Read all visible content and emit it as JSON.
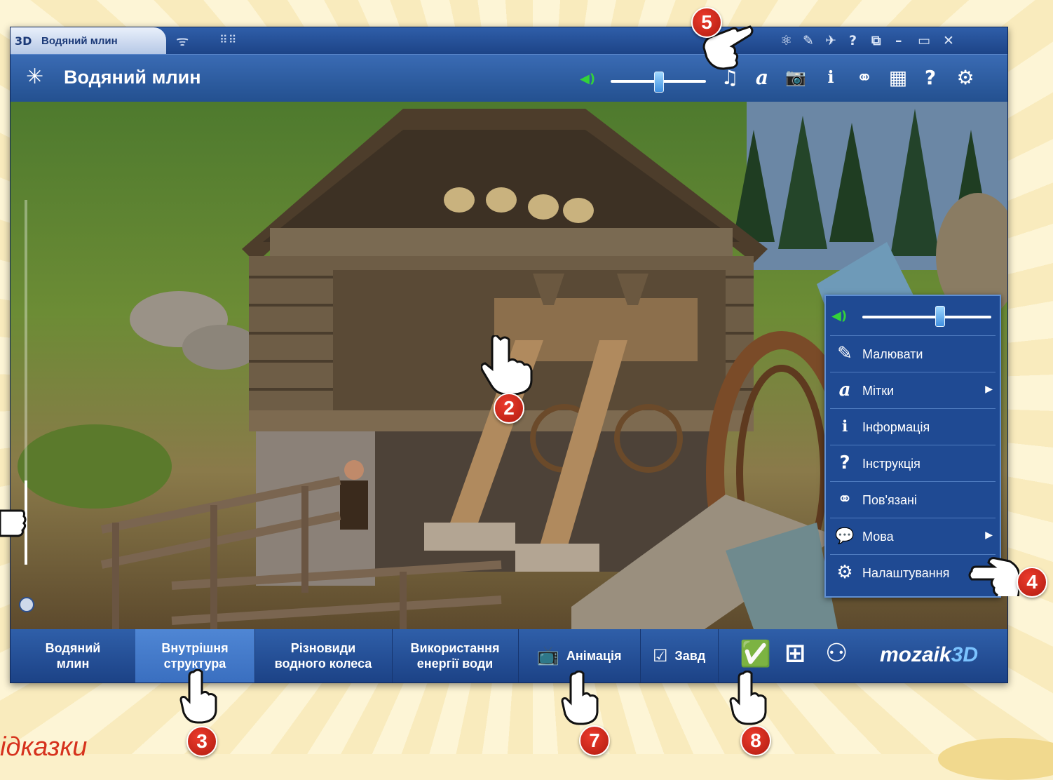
{
  "window": {
    "tab_badge": "3D",
    "tab_title": "Водяний млин",
    "titlebar_icons": [
      "molecule-icon",
      "pencil-icon",
      "pin-icon",
      "help-icon",
      "external-link-icon",
      "minimize-icon",
      "maximize-icon",
      "close-icon"
    ],
    "titlebar_glyphs": [
      "⚛",
      "✎",
      "✈",
      "?",
      "⧉",
      "–",
      "▭",
      "✕"
    ]
  },
  "header": {
    "title": "Водяний млин",
    "volume_level": 0.5,
    "icons": [
      "music-icon",
      "labels-icon",
      "camera-icon",
      "info-icon",
      "link-icon",
      "grid-icon",
      "help-icon",
      "gear-icon"
    ],
    "glyphs": [
      "♫",
      "a",
      "📷",
      "ℹ",
      "⚭",
      "▦",
      "?",
      "⚙"
    ]
  },
  "bottom_tabs": [
    {
      "label": "Водяний\nмлин",
      "active": false
    },
    {
      "label": "Внутрішня\nструктура",
      "active": true
    },
    {
      "label": "Різновиди\nводного колеса",
      "active": false
    },
    {
      "label": "Використання\nенергії води",
      "active": false
    },
    {
      "label": "Анімація",
      "active": false
    },
    {
      "label": "Завд",
      "active": false
    }
  ],
  "bottom_icons": [
    "task-check-icon",
    "add-task-icon",
    "add-user-icon"
  ],
  "brand": {
    "text": "mozaik",
    "accent": "3D"
  },
  "menu": {
    "volume_level": 0.6,
    "items": [
      {
        "icon": "pencil-icon",
        "glyph": "✎",
        "label": "Малювати",
        "submenu": false
      },
      {
        "icon": "labels-icon",
        "glyph": "a",
        "label": "Мітки",
        "submenu": true
      },
      {
        "icon": "info-icon",
        "glyph": "ℹ",
        "label": "Інформація",
        "submenu": false
      },
      {
        "icon": "help-icon",
        "glyph": "?",
        "label": "Інструкція",
        "submenu": false
      },
      {
        "icon": "link-icon",
        "glyph": "⚭",
        "label": "Пов'язані",
        "submenu": false
      },
      {
        "icon": "language-icon",
        "glyph": "💬",
        "label": "Мова",
        "submenu": true
      },
      {
        "icon": "gear-icon",
        "glyph": "⚙",
        "label": "Налаштування",
        "submenu": false
      }
    ]
  },
  "callouts": [
    "2",
    "3",
    "4",
    "5",
    "7",
    "8"
  ],
  "footer_hint": "ідказки",
  "colors": {
    "accent": "#1f4a93",
    "callout": "#d42b1d",
    "active_tab": "#3a6fc0"
  }
}
